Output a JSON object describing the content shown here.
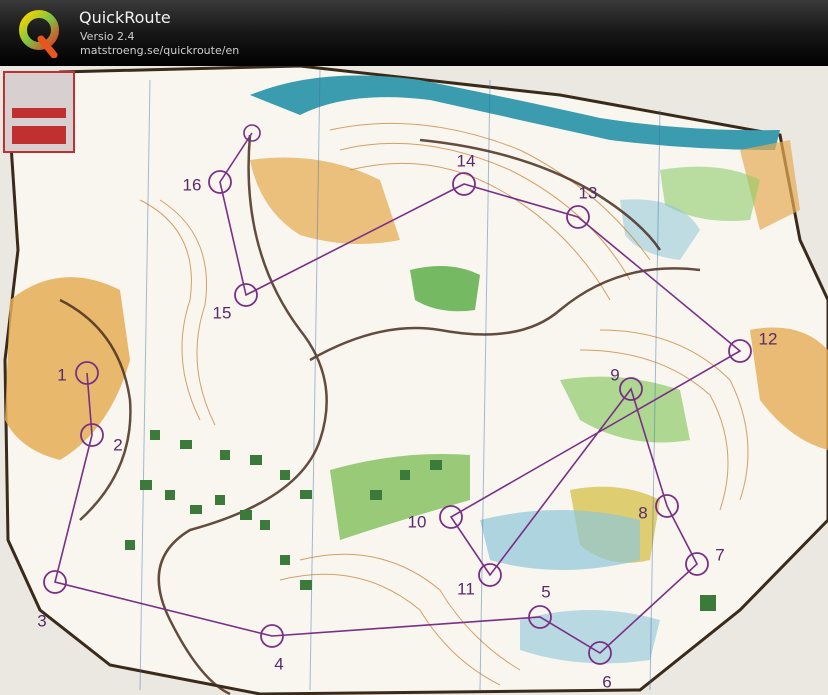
{
  "app": {
    "title": "QuickRoute",
    "version": "Versio 2.4",
    "url": "matstroeng.se/quickroute/en"
  },
  "map": {
    "controls": [
      {
        "label": "1"
      },
      {
        "label": "2"
      },
      {
        "label": "3"
      },
      {
        "label": "4"
      },
      {
        "label": "5"
      },
      {
        "label": "6"
      },
      {
        "label": "7"
      },
      {
        "label": "8"
      },
      {
        "label": "9"
      },
      {
        "label": "10"
      },
      {
        "label": "11"
      },
      {
        "label": "12"
      },
      {
        "label": "13"
      },
      {
        "label": "14"
      },
      {
        "label": "15"
      },
      {
        "label": "16"
      }
    ],
    "colors": {
      "course": "#7a2f86",
      "water": "#3a9cae",
      "open": "#e0a64a",
      "vegetation": "#7fbf5a",
      "contours": "#c77b2c"
    }
  }
}
